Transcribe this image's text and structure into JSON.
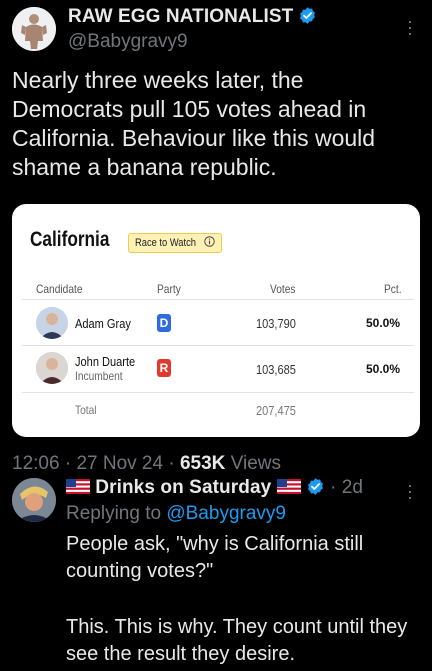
{
  "tweet": {
    "display_name": "RAW EGG NATIONALIST",
    "handle": "@Babygravy9",
    "text": "Nearly three weeks later, the Democrats pull 105 votes ahead in California. Behaviour like this would shame a banana republic.",
    "time": "12:06",
    "date": "27 Nov 24",
    "views_count": "653K",
    "views_label": "Views",
    "sep": "·"
  },
  "card": {
    "state": "California",
    "race_badge": "Race to Watch",
    "headers": {
      "candidate": "Candidate",
      "party": "Party",
      "votes": "Votes",
      "pct": "Pct."
    },
    "rows": [
      {
        "name": "Adam Gray",
        "sub": "",
        "party": "D",
        "votes": "103,790",
        "pct": "50.0%"
      },
      {
        "name": "John Duarte",
        "sub": "Incumbent",
        "party": "R",
        "votes": "103,685",
        "pct": "50.0%"
      }
    ],
    "total_label": "Total",
    "total_votes": "207,475"
  },
  "reply": {
    "display_name": "Drinks on Saturday",
    "age": "2d",
    "sep": "·",
    "replying_prefix": "Replying to",
    "replying_handle": "@Babygravy9",
    "text_1": "People ask, \"why is California still counting votes?\"",
    "text_2": "This. This is why. They count until they see the result they desire."
  },
  "colors": {
    "dem": "#2f6bde",
    "rep": "#e03a2f",
    "link": "#1d9bf0",
    "verified": "#1d9bf0"
  },
  "icons": [
    "verified-badge-icon",
    "more-options-icon",
    "info-icon",
    "us-flag-icon"
  ]
}
